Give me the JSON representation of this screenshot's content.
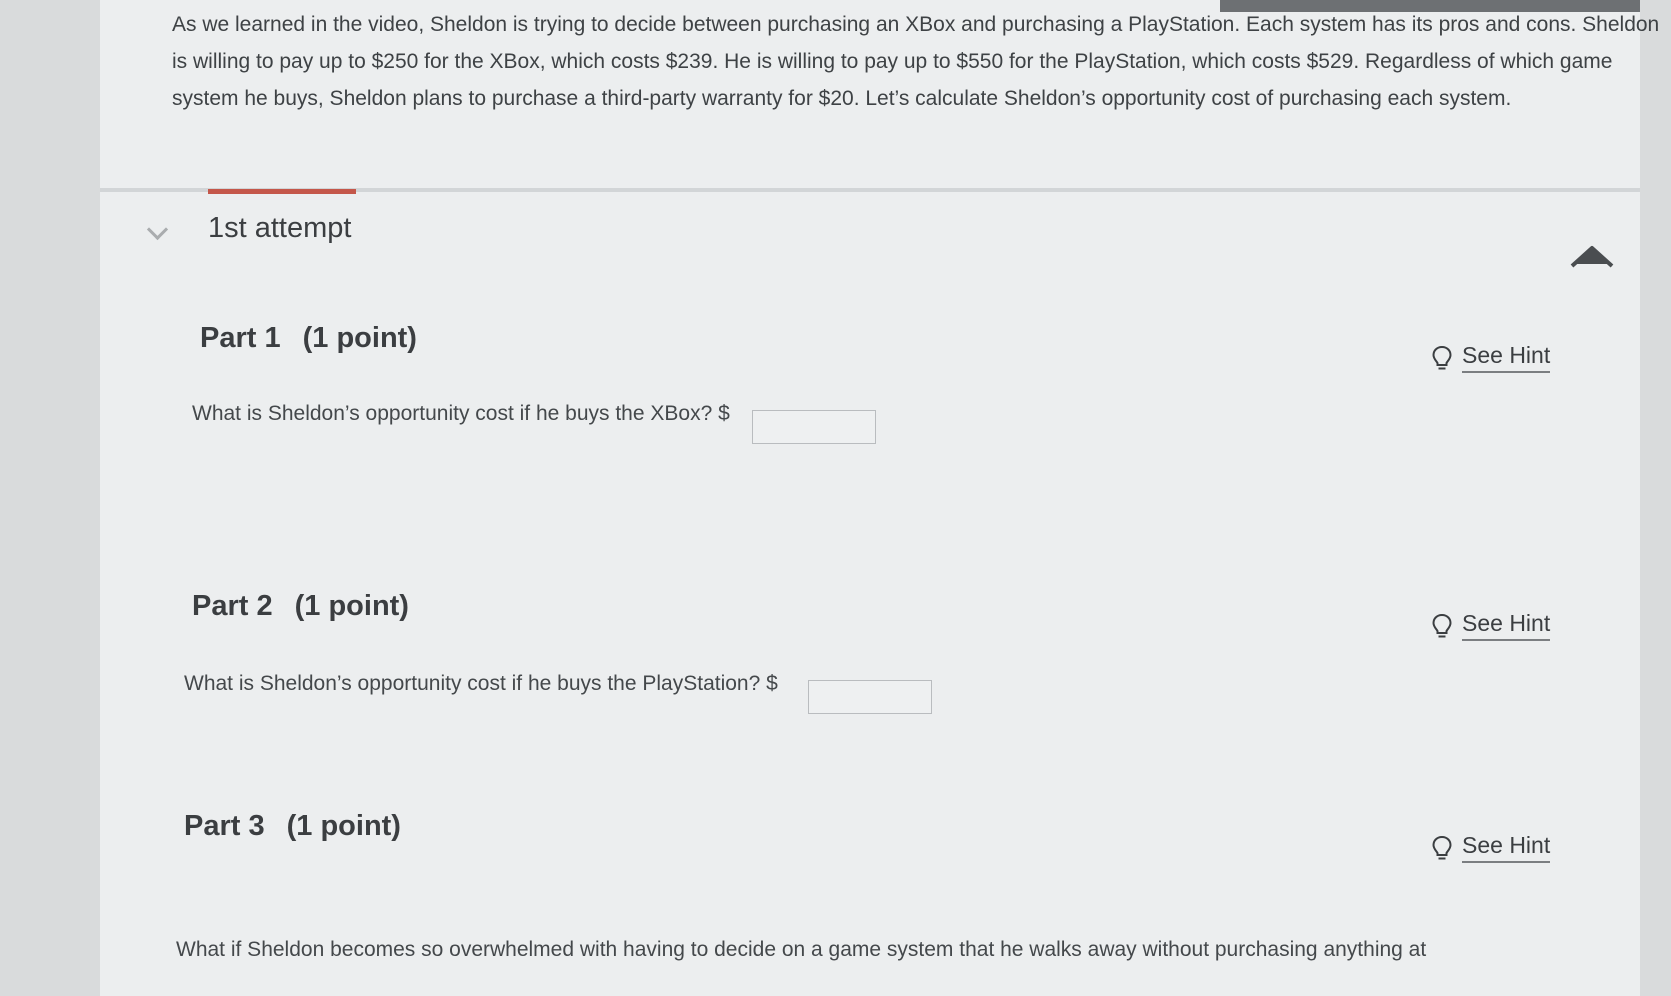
{
  "intro": {
    "text": "As we learned in the video, Sheldon is trying to decide between purchasing an XBox and purchasing a PlayStation. Each system has its pros and cons. Sheldon is willing to pay up to $250 for the XBox, which costs $239. He is willing to pay up to $550 for the PlayStation, which costs $529. Regardless of which game system he buys, Sheldon plans to purchase a third-party warranty for $20. Let’s calculate Sheldon’s opportunity cost of purchasing each system."
  },
  "attempt": {
    "title": "1st attempt"
  },
  "parts": [
    {
      "title": "Part 1",
      "points": "(1 point)",
      "hint_label": "See Hint",
      "question": "What is Sheldon’s opportunity cost if he buys the XBox? $",
      "answer_value": ""
    },
    {
      "title": "Part 2",
      "points": "(1 point)",
      "hint_label": "See Hint",
      "question": "What is Sheldon’s opportunity cost if he buys the PlayStation? $",
      "answer_value": ""
    },
    {
      "title": "Part 3",
      "points": "(1 point)",
      "hint_label": "See Hint",
      "question": "What if Sheldon becomes so overwhelmed with having to decide on a game system that he walks away without purchasing anything at"
    }
  ],
  "colors": {
    "accent": "#c4574a",
    "page_bg": "#eceeef",
    "text": "#3b3e41"
  },
  "icons": {
    "collapse": "chevron-down-icon",
    "scroll_top": "arrow-up-icon",
    "hint": "lightbulb-icon"
  }
}
